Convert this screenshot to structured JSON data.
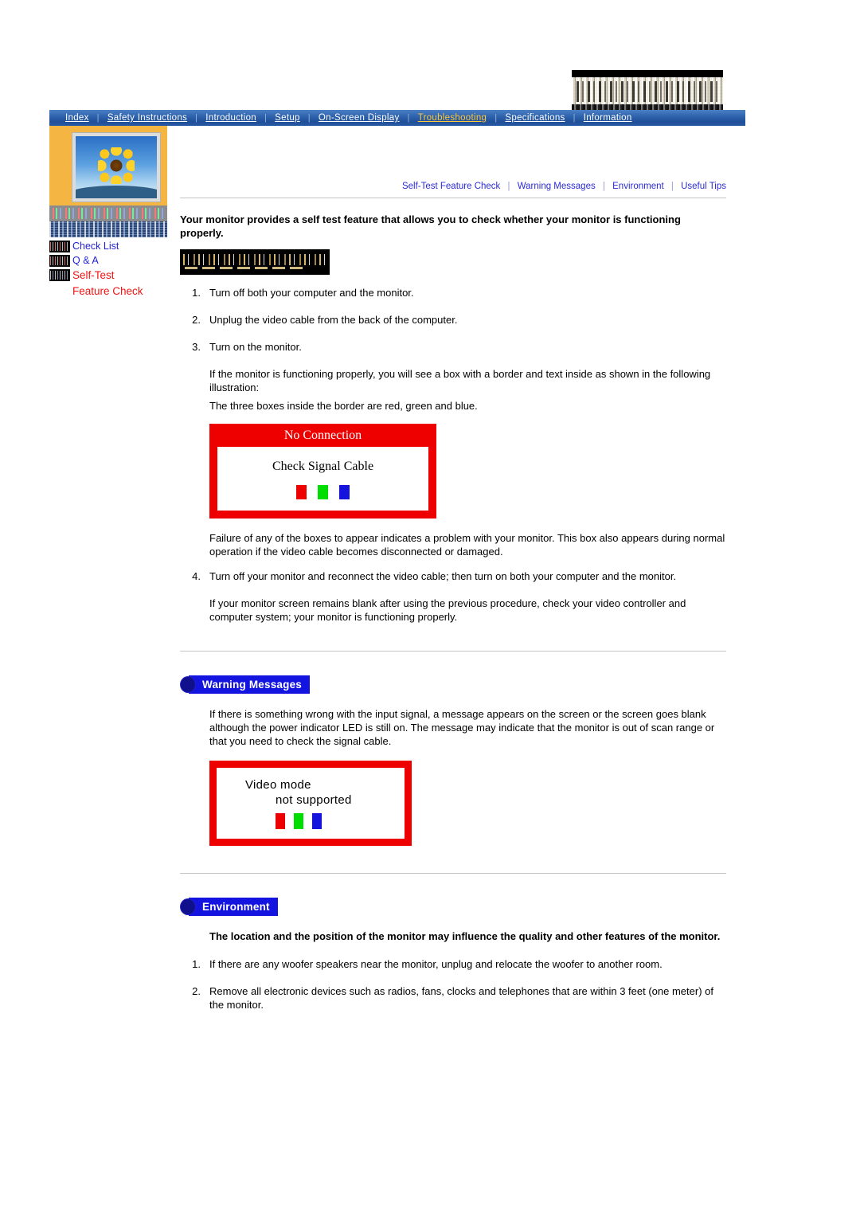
{
  "nav": {
    "items": [
      {
        "label": "Index",
        "active": false
      },
      {
        "label": "Safety Instructions",
        "active": false
      },
      {
        "label": "Introduction",
        "active": false
      },
      {
        "label": "Setup",
        "active": false
      },
      {
        "label": "On-Screen Display",
        "active": false
      },
      {
        "label": "Troubleshooting",
        "active": true
      },
      {
        "label": "Specifications",
        "active": false
      },
      {
        "label": "Information",
        "active": false
      }
    ],
    "separator": "|",
    "active_color": "#ffc93a",
    "bar_color": "#204f98"
  },
  "sidebar": {
    "links": [
      {
        "label": "Check List",
        "color": "#1f1fd6",
        "active": false
      },
      {
        "label": "Q & A",
        "color": "#1f1fd6",
        "active": false
      },
      {
        "label": "Self-Test",
        "sublabel": "Feature Check",
        "color": "#f01414",
        "active": true
      }
    ]
  },
  "subnav": {
    "items": [
      "Self-Test Feature Check",
      "Warning Messages",
      "Environment",
      "Useful Tips"
    ],
    "separator": "|",
    "link_color": "#2b2bd4"
  },
  "selftest": {
    "lead": "Your monitor provides a self test feature that allows you to check whether your monitor is functioning properly.",
    "steps": [
      {
        "num": "1.",
        "text": "Turn off both your computer and the monitor."
      },
      {
        "num": "2.",
        "text": "Unplug the video cable from the back of the computer."
      },
      {
        "num": "3.",
        "text": "Turn on the monitor."
      }
    ],
    "after_step3_a": "If the monitor is functioning properly, you will see a box with a border and text inside as shown in the following illustration:",
    "after_step3_b": "The three boxes inside the border are red, green and blue.",
    "illustration": {
      "title": "No Connection",
      "message": "Check Signal Cable",
      "swatch_colors": [
        "#ee0000",
        "#00dd00",
        "#1414dd"
      ],
      "frame_color": "#ee0000"
    },
    "failure_note": "Failure of any of the boxes to appear indicates a problem with your monitor. This box also appears during normal operation if the video cable becomes disconnected or damaged.",
    "step4": {
      "num": "4.",
      "text": "Turn off your monitor and reconnect the video cable; then turn on both your computer and the monitor."
    },
    "closing": "If your monitor screen remains blank after using the previous procedure, check your video controller and computer system; your monitor is functioning properly."
  },
  "warning": {
    "heading": "Warning Messages",
    "body": "If there is something wrong with the input signal, a message appears on the screen or the screen goes blank although the power indicator LED is still on. The message may indicate that the monitor is out of scan range or that you need to check the signal cable.",
    "illustration": {
      "line1": "Video mode",
      "line2": "not  supported",
      "swatch_colors": [
        "#ee0000",
        "#00dd00",
        "#1414dd"
      ],
      "frame_color": "#ee0000"
    }
  },
  "environment": {
    "heading": "Environment",
    "lead": "The location and the position of the monitor may influence the quality and other features of the monitor.",
    "items": [
      {
        "num": "1.",
        "text": "If there are any woofer speakers near the monitor, unplug and relocate the woofer to another room."
      },
      {
        "num": "2.",
        "text": "Remove all electronic devices such as radios, fans, clocks and telephones that are within 3 feet (one meter) of the monitor."
      }
    ]
  }
}
